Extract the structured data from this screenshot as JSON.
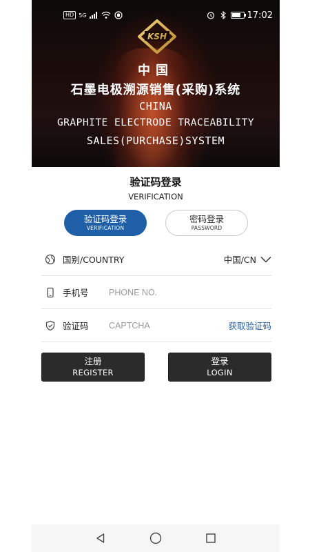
{
  "status_bar": {
    "left_chip": "HD",
    "network": "5G",
    "time": "17:02",
    "icons": [
      "signal-icon",
      "wifi-icon",
      "notification-icon",
      "alarm-icon",
      "bluetooth-icon",
      "battery-icon"
    ]
  },
  "banner": {
    "logo_text": "KSH",
    "title_cn_short": "中国",
    "title_cn_full": "石墨电极溯源销售(采购)系统",
    "title_en_line1": "CHINA",
    "title_en_line2": "GRAPHITE ELECTRODE TRACEABILITY",
    "title_en_line3": "SALES(PURCHASE)SYSTEM"
  },
  "heading": {
    "cn": "验证码登录",
    "en": "VERIFICATION"
  },
  "login_modes": [
    {
      "cn": "验证码登录",
      "en": "VERIFICATION",
      "active": true
    },
    {
      "cn": "密码登录",
      "en": "PASSWORD",
      "active": false
    }
  ],
  "form": {
    "country": {
      "label": "国别/COUNTRY",
      "value": "中国/CN"
    },
    "phone": {
      "label": "手机号",
      "placeholder": "PHONE NO."
    },
    "captcha": {
      "label": "验证码",
      "placeholder": "CAPTCHA",
      "action": "获取验证码"
    }
  },
  "actions": {
    "register": {
      "cn": "注册",
      "en": "REGISTER"
    },
    "login": {
      "cn": "登录",
      "en": "LOGIN"
    }
  },
  "colors": {
    "accent": "#1f5fa8",
    "button_dark": "#2b2b2b"
  }
}
